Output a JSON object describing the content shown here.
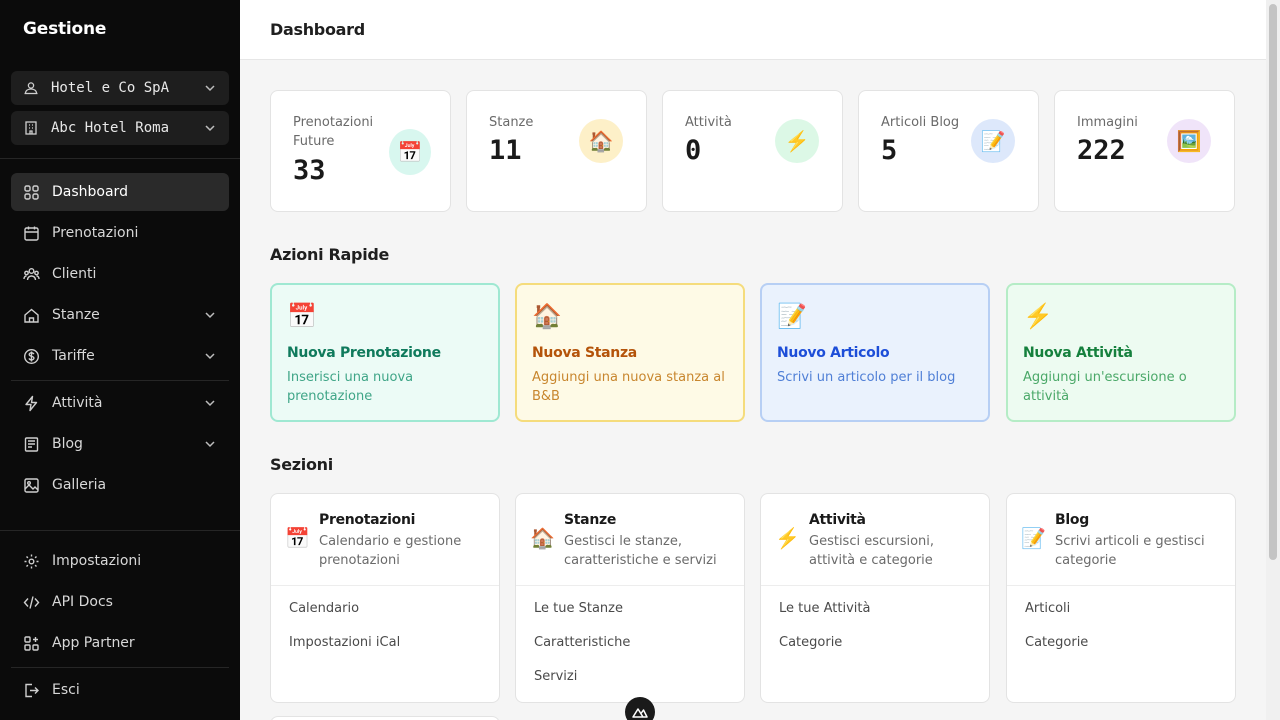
{
  "sidebar": {
    "brand": "Gestione",
    "company": "Hotel e Co SpA",
    "property": "Abc Hotel Roma",
    "nav": [
      {
        "label": "Dashboard",
        "icon": "grid-icon"
      },
      {
        "label": "Prenotazioni",
        "icon": "calendar-icon"
      },
      {
        "label": "Clienti",
        "icon": "users-icon"
      },
      {
        "label": "Stanze",
        "icon": "home-icon"
      },
      {
        "label": "Tariffe",
        "icon": "dollar-icon"
      },
      {
        "label": "Attività",
        "icon": "bolt-icon"
      },
      {
        "label": "Blog",
        "icon": "newspaper-icon"
      },
      {
        "label": "Galleria",
        "icon": "image-icon"
      }
    ],
    "bottom": [
      {
        "label": "Impostazioni",
        "icon": "gear-icon"
      },
      {
        "label": "API Docs",
        "icon": "code-icon"
      },
      {
        "label": "App Partner",
        "icon": "apps-icon"
      },
      {
        "label": "Esci",
        "icon": "logout-icon"
      }
    ]
  },
  "header": {
    "title": "Dashboard"
  },
  "stats": [
    {
      "label": "Prenotazioni Future",
      "value": "33",
      "emoji": "📅",
      "color": "#d8f7ef"
    },
    {
      "label": "Stanze",
      "value": "11",
      "emoji": "🏠",
      "color": "#fdf0c8"
    },
    {
      "label": "Attività",
      "value": "0",
      "emoji": "⚡",
      "color": "#dcf8e6"
    },
    {
      "label": "Articoli Blog",
      "value": "5",
      "emoji": "📝",
      "color": "#dde8fb"
    },
    {
      "label": "Immagini",
      "value": "222",
      "emoji": "🖼️",
      "color": "#f0e4f9"
    }
  ],
  "quick_actions": {
    "title": "Azioni Rapide",
    "items": [
      {
        "title": "Nuova Prenotazione",
        "desc": "Inserisci una nuova prenotazione",
        "emoji": "📅"
      },
      {
        "title": "Nuova Stanza",
        "desc": "Aggiungi una nuova stanza al B&B",
        "emoji": "🏠"
      },
      {
        "title": "Nuovo Articolo",
        "desc": "Scrivi un articolo per il blog",
        "emoji": "📝"
      },
      {
        "title": "Nuova Attività",
        "desc": "Aggiungi un'escursione o attività",
        "emoji": "⚡"
      }
    ]
  },
  "sections": {
    "title": "Sezioni",
    "items": [
      {
        "title": "Prenotazioni",
        "desc": "Calendario e gestione prenotazioni",
        "emoji": "📅",
        "links": [
          "Calendario",
          "Impostazioni iCal"
        ]
      },
      {
        "title": "Stanze",
        "desc": "Gestisci le stanze, caratteristiche e servizi",
        "emoji": "🏠",
        "links": [
          "Le tue Stanze",
          "Caratteristiche",
          "Servizi"
        ]
      },
      {
        "title": "Attività",
        "desc": "Gestisci escursioni, attività e categorie",
        "emoji": "⚡",
        "links": [
          "Le tue Attività",
          "Categorie"
        ]
      },
      {
        "title": "Blog",
        "desc": "Scrivi articoli e gestisci categorie",
        "emoji": "📝",
        "links": [
          "Articoli",
          "Categorie"
        ]
      }
    ]
  }
}
